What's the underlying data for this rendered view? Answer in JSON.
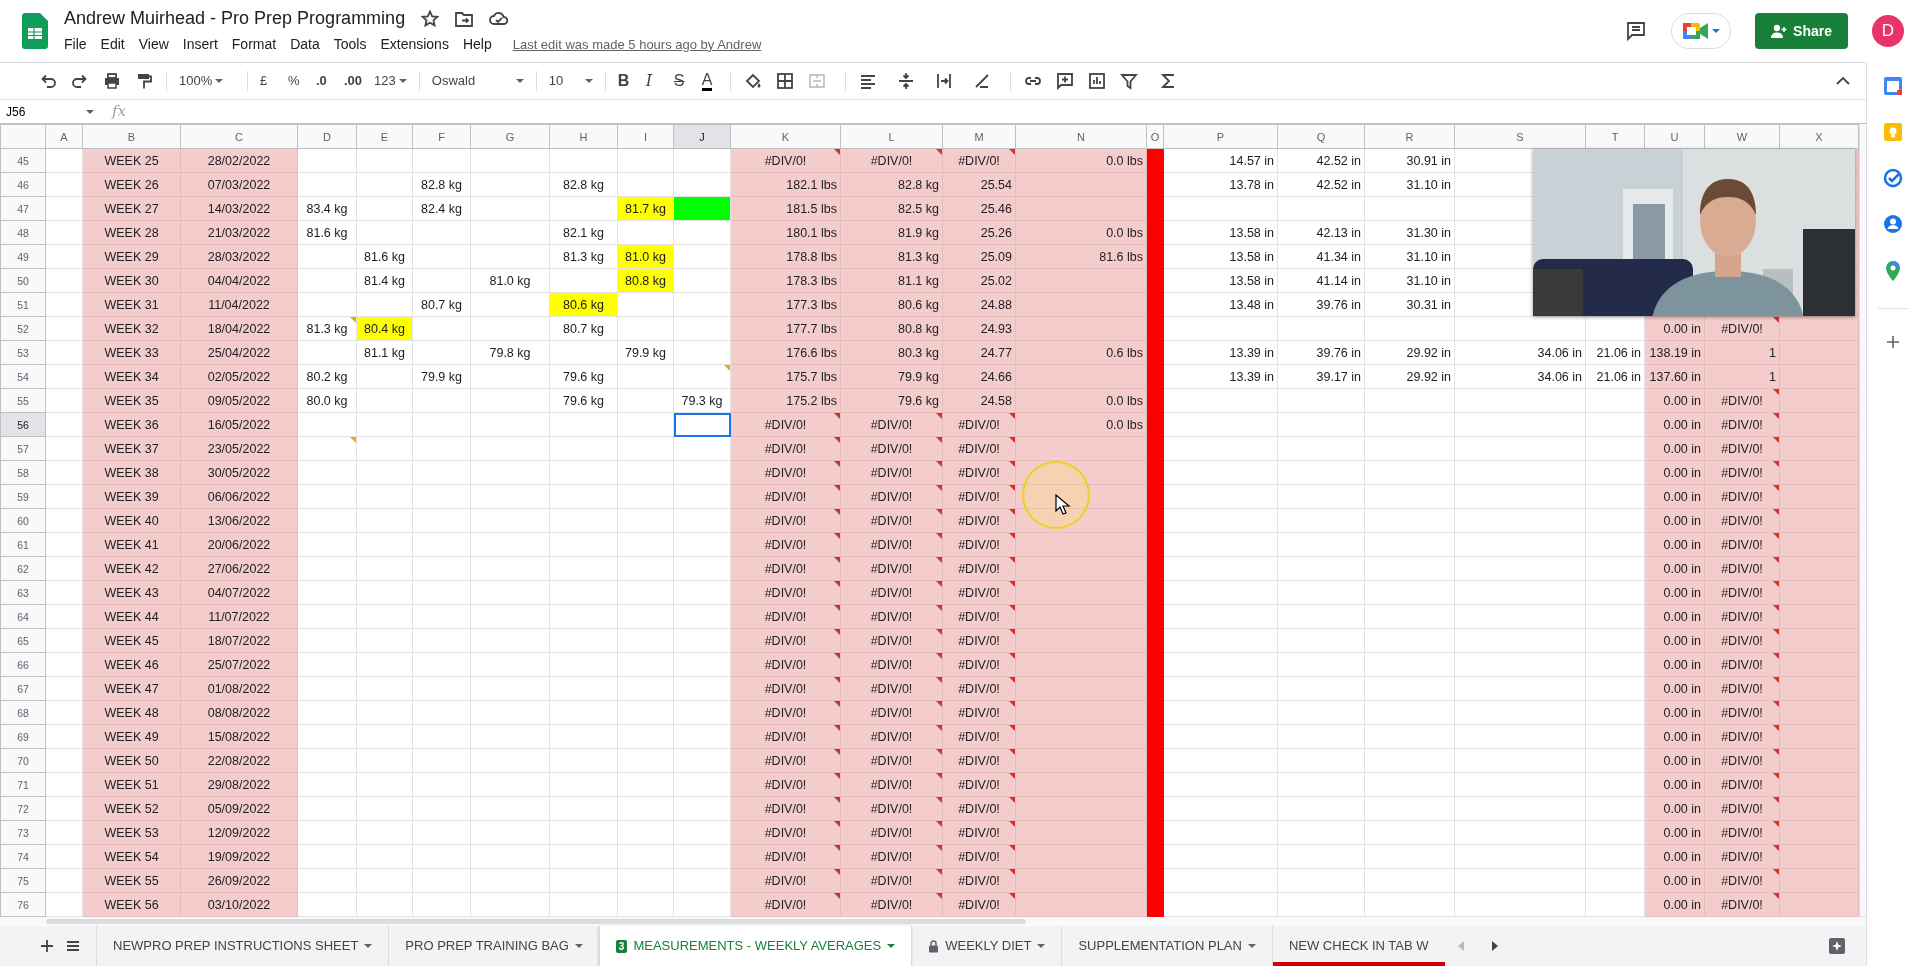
{
  "document": {
    "title": "Andrew Muirhead - Pro Prep Programming",
    "last_edit": "Last edit was made 5 hours ago by Andrew"
  },
  "menu": [
    "File",
    "Edit",
    "View",
    "Insert",
    "Format",
    "Data",
    "Tools",
    "Extensions",
    "Help"
  ],
  "share_button": "Share",
  "avatar": "D",
  "toolbar": {
    "zoom": "100%",
    "currency": "£",
    "percent": "%",
    "decrease_decimals": ".0",
    "increase_decimals": ".00",
    "number_format": "123",
    "font": "Oswald",
    "font_size": "10",
    "bold": "B",
    "italic": "I",
    "strikethrough": "S",
    "text_color": "A"
  },
  "name_box": "J56",
  "formula_label": "fx",
  "columns": [
    {
      "letter": "A",
      "selected": false
    },
    {
      "letter": "B",
      "selected": false,
      "color": "#f4cccc"
    },
    {
      "letter": "C",
      "selected": false,
      "color": "#f4cccc"
    },
    {
      "letter": "D",
      "selected": false
    },
    {
      "letter": "E",
      "selected": false
    },
    {
      "letter": "F",
      "selected": false
    },
    {
      "letter": "G",
      "selected": false
    },
    {
      "letter": "H",
      "selected": false
    },
    {
      "letter": "I",
      "selected": false
    },
    {
      "letter": "J",
      "selected": true
    },
    {
      "letter": "K",
      "selected": false,
      "color": "#f4cccc"
    },
    {
      "letter": "L",
      "selected": false,
      "color": "#f4cccc"
    },
    {
      "letter": "M",
      "selected": false,
      "color": "#f4cccc"
    },
    {
      "letter": "N",
      "selected": false,
      "color": "#f4cccc"
    },
    {
      "letter": "O",
      "selected": false,
      "color": "#ff0000"
    },
    {
      "letter": "P",
      "selected": false
    },
    {
      "letter": "Q",
      "selected": false
    },
    {
      "letter": "R",
      "selected": false
    },
    {
      "letter": "S",
      "selected": false
    },
    {
      "letter": "T",
      "selected": false
    },
    {
      "letter": "U",
      "selected": false,
      "color": "#f4cccc"
    },
    {
      "letter": "W",
      "selected": false,
      "color": "#f4cccc"
    },
    {
      "letter": "X",
      "selected": false,
      "color": "#f4cccc"
    }
  ],
  "rows": [
    {
      "number": "45",
      "selected": false,
      "cells": {
        "B": {
          "text": "WEEK 25",
          "kind": "value"
        },
        "C": {
          "text": "28/02/2022",
          "kind": "value"
        },
        "K": {
          "text": "#DIV/0!",
          "kind": "error"
        },
        "L": {
          "text": "#DIV/0!",
          "kind": "error"
        },
        "M": {
          "text": "#DIV/0!",
          "kind": "error"
        },
        "N": {
          "text": "0.0 lbs",
          "kind": "value"
        },
        "P": {
          "text": "14.57 in",
          "kind": "value"
        },
        "Q": {
          "text": "42.52 in",
          "kind": "value"
        },
        "R": {
          "text": "30.91 in",
          "kind": "value"
        }
      }
    },
    {
      "number": "46",
      "selected": false,
      "cells": {
        "B": {
          "text": "WEEK 26",
          "kind": "value"
        },
        "C": {
          "text": "07/03/2022",
          "kind": "value"
        },
        "F": {
          "text": "82.8 kg",
          "kind": "value"
        },
        "H": {
          "text": "82.8 kg",
          "kind": "value"
        },
        "K": {
          "text": "182.1 lbs",
          "kind": "value"
        },
        "L": {
          "text": "82.8 kg",
          "kind": "value"
        },
        "M": {
          "text": "25.54",
          "kind": "value"
        },
        "P": {
          "text": "13.78 in",
          "kind": "value"
        },
        "Q": {
          "text": "42.52 in",
          "kind": "value"
        },
        "R": {
          "text": "31.10 in",
          "kind": "value"
        }
      }
    },
    {
      "number": "47",
      "selected": false,
      "cells": {
        "B": {
          "text": "WEEK 27",
          "kind": "value"
        },
        "C": {
          "text": "14/03/2022",
          "kind": "value"
        },
        "D": {
          "text": "83.4 kg",
          "kind": "value"
        },
        "F": {
          "text": "82.4 kg",
          "kind": "value"
        },
        "I": {
          "text": "81.7 kg",
          "kind": "value",
          "color": "#ffff00"
        },
        "J": {
          "color": "#00ff00"
        },
        "K": {
          "text": "181.5 lbs",
          "kind": "value"
        },
        "L": {
          "text": "82.5 kg",
          "kind": "value"
        },
        "M": {
          "text": "25.46",
          "kind": "value"
        }
      }
    },
    {
      "number": "48",
      "selected": false,
      "cells": {
        "B": {
          "text": "WEEK 28",
          "kind": "value"
        },
        "C": {
          "text": "21/03/2022",
          "kind": "value"
        },
        "D": {
          "text": "81.6 kg",
          "kind": "value"
        },
        "H": {
          "text": "82.1 kg",
          "kind": "value"
        },
        "K": {
          "text": "180.1 lbs",
          "kind": "value"
        },
        "L": {
          "text": "81.9 kg",
          "kind": "value"
        },
        "M": {
          "text": "25.26",
          "kind": "value"
        },
        "N": {
          "text": "0.0 lbs",
          "kind": "value"
        },
        "P": {
          "text": "13.58 in",
          "kind": "value"
        },
        "Q": {
          "text": "42.13 in",
          "kind": "value"
        },
        "R": {
          "text": "31.30 in",
          "kind": "value"
        }
      }
    },
    {
      "number": "49",
      "selected": false,
      "cells": {
        "B": {
          "text": "WEEK 29",
          "kind": "value"
        },
        "C": {
          "text": "28/03/2022",
          "kind": "value"
        },
        "E": {
          "text": "81.6 kg",
          "kind": "value"
        },
        "H": {
          "text": "81.3 kg",
          "kind": "value"
        },
        "I": {
          "text": "81.0 kg",
          "kind": "value",
          "color": "#ffff00"
        },
        "K": {
          "text": "178.8 lbs",
          "kind": "value"
        },
        "L": {
          "text": "81.3 kg",
          "kind": "value"
        },
        "M": {
          "text": "25.09",
          "kind": "value"
        },
        "N": {
          "text": "81.6 lbs",
          "kind": "value"
        },
        "P": {
          "text": "13.58 in",
          "kind": "value"
        },
        "Q": {
          "text": "41.34 in",
          "kind": "value"
        },
        "R": {
          "text": "31.10 in",
          "kind": "value"
        }
      }
    },
    {
      "number": "50",
      "selected": false,
      "cells": {
        "B": {
          "text": "WEEK 30",
          "kind": "value"
        },
        "C": {
          "text": "04/04/2022",
          "kind": "value"
        },
        "E": {
          "text": "81.4 kg",
          "kind": "value"
        },
        "G": {
          "text": "81.0 kg",
          "kind": "value"
        },
        "I": {
          "text": "80.8 kg",
          "kind": "value",
          "color": "#ffff00"
        },
        "K": {
          "text": "178.3 lbs",
          "kind": "value"
        },
        "L": {
          "text": "81.1 kg",
          "kind": "value"
        },
        "M": {
          "text": "25.02",
          "kind": "value"
        },
        "P": {
          "text": "13.58 in",
          "kind": "value"
        },
        "Q": {
          "text": "41.14 in",
          "kind": "value"
        },
        "R": {
          "text": "31.10 in",
          "kind": "value"
        }
      }
    },
    {
      "number": "51",
      "selected": false,
      "cells": {
        "B": {
          "text": "WEEK 31",
          "kind": "value"
        },
        "C": {
          "text": "11/04/2022",
          "kind": "value"
        },
        "F": {
          "text": "80.7 kg",
          "kind": "value"
        },
        "H": {
          "text": "80.6 kg",
          "kind": "value",
          "color": "#ffff00"
        },
        "K": {
          "text": "177.3 lbs",
          "kind": "value"
        },
        "L": {
          "text": "80.6 kg",
          "kind": "value"
        },
        "M": {
          "text": "24.88",
          "kind": "value"
        },
        "P": {
          "text": "13.48 in",
          "kind": "value"
        },
        "Q": {
          "text": "39.76 in",
          "kind": "value"
        },
        "R": {
          "text": "30.31 in",
          "kind": "value"
        }
      }
    },
    {
      "number": "52",
      "selected": false,
      "cells": {
        "B": {
          "text": "WEEK 32",
          "kind": "value"
        },
        "C": {
          "text": "18/04/2022",
          "kind": "value"
        },
        "D": {
          "text": "81.3 kg",
          "kind": "value",
          "note": true
        },
        "E": {
          "text": "80.4 kg",
          "kind": "value",
          "color": "#ffff00"
        },
        "H": {
          "text": "80.7 kg",
          "kind": "value"
        },
        "K": {
          "text": "177.7 lbs",
          "kind": "value"
        },
        "L": {
          "text": "80.8 kg",
          "kind": "value"
        },
        "M": {
          "text": "24.93",
          "kind": "value"
        },
        "U": {
          "text": "0.00 in",
          "kind": "value"
        },
        "W": {
          "text": "#DIV/0!",
          "kind": "error"
        }
      }
    },
    {
      "number": "53",
      "selected": false,
      "cells": {
        "B": {
          "text": "WEEK 33",
          "kind": "value"
        },
        "C": {
          "text": "25/04/2022",
          "kind": "value"
        },
        "E": {
          "text": "81.1 kg",
          "kind": "value"
        },
        "G": {
          "text": "79.8 kg",
          "kind": "value"
        },
        "I": {
          "text": "79.9 kg",
          "kind": "value"
        },
        "K": {
          "text": "176.6 lbs",
          "kind": "value"
        },
        "L": {
          "text": "80.3 kg",
          "kind": "value"
        },
        "M": {
          "text": "24.77",
          "kind": "value"
        },
        "N": {
          "text": "0.6 lbs",
          "kind": "value"
        },
        "P": {
          "text": "13.39 in",
          "kind": "value"
        },
        "Q": {
          "text": "39.76 in",
          "kind": "value"
        },
        "R": {
          "text": "29.92 in",
          "kind": "value"
        },
        "S": {
          "text": "34.06 in",
          "kind": "value"
        },
        "T": {
          "text": "21.06 in",
          "kind": "value"
        },
        "U": {
          "text": "138.19 in",
          "kind": "value"
        },
        "W": {
          "text": "1",
          "kind": "value"
        }
      }
    },
    {
      "number": "54",
      "selected": false,
      "cells": {
        "B": {
          "text": "WEEK 34",
          "kind": "value"
        },
        "C": {
          "text": "02/05/2022",
          "kind": "value"
        },
        "D": {
          "text": "80.2 kg",
          "kind": "value"
        },
        "F": {
          "text": "79.9 kg",
          "kind": "value"
        },
        "H": {
          "text": "79.6 kg",
          "kind": "value"
        },
        "J": {
          "note": true
        },
        "K": {
          "text": "175.7 lbs",
          "kind": "value"
        },
        "L": {
          "text": "79.9 kg",
          "kind": "value"
        },
        "M": {
          "text": "24.66",
          "kind": "value"
        },
        "P": {
          "text": "13.39 in",
          "kind": "value"
        },
        "Q": {
          "text": "39.17 in",
          "kind": "value"
        },
        "R": {
          "text": "29.92 in",
          "kind": "value"
        },
        "S": {
          "text": "34.06 in",
          "kind": "value"
        },
        "T": {
          "text": "21.06 in",
          "kind": "value"
        },
        "U": {
          "text": "137.60 in",
          "kind": "value"
        },
        "W": {
          "text": "1",
          "kind": "value"
        }
      }
    },
    {
      "number": "55",
      "selected": false,
      "cells": {
        "B": {
          "text": "WEEK 35",
          "kind": "value"
        },
        "C": {
          "text": "09/05/2022",
          "kind": "value"
        },
        "D": {
          "text": "80.0 kg",
          "kind": "value"
        },
        "H": {
          "text": "79.6 kg",
          "kind": "value"
        },
        "J": {
          "text": "79.3 kg",
          "kind": "value"
        },
        "K": {
          "text": "175.2 lbs",
          "kind": "value"
        },
        "L": {
          "text": "79.6 kg",
          "kind": "value"
        },
        "M": {
          "text": "24.58",
          "kind": "value"
        },
        "N": {
          "text": "0.0 lbs",
          "kind": "value"
        },
        "U": {
          "text": "0.00 in",
          "kind": "value"
        },
        "W": {
          "text": "#DIV/0!",
          "kind": "error"
        }
      }
    },
    {
      "number": "56",
      "selected": true,
      "cells": {
        "B": {
          "text": "WEEK 36",
          "kind": "value"
        },
        "C": {
          "text": "16/05/2022",
          "kind": "value"
        },
        "J": {
          "selected": true
        },
        "K": {
          "text": "#DIV/0!",
          "kind": "error"
        },
        "L": {
          "text": "#DIV/0!",
          "kind": "error"
        },
        "M": {
          "text": "#DIV/0!",
          "kind": "error"
        },
        "N": {
          "text": "0.0 lbs",
          "kind": "value"
        },
        "U": {
          "text": "0.00 in",
          "kind": "value"
        },
        "W": {
          "text": "#DIV/0!",
          "kind": "error"
        }
      }
    },
    {
      "number": "57",
      "selected": false,
      "cells": {
        "B": {
          "text": "WEEK 37",
          "kind": "value"
        },
        "C": {
          "text": "23/05/2022",
          "kind": "value"
        },
        "D": {
          "note": true
        },
        "K": {
          "text": "#DIV/0!",
          "kind": "error"
        },
        "L": {
          "text": "#DIV/0!",
          "kind": "error"
        },
        "M": {
          "text": "#DIV/0!",
          "kind": "error"
        },
        "U": {
          "text": "0.00 in",
          "kind": "value"
        },
        "W": {
          "text": "#DIV/0!",
          "kind": "error"
        }
      }
    },
    {
      "number": "58",
      "selected": false,
      "cells": {
        "B": {
          "text": "WEEK 38",
          "kind": "value"
        },
        "C": {
          "text": "30/05/2022",
          "kind": "value"
        },
        "K": {
          "text": "#DIV/0!",
          "kind": "error"
        },
        "L": {
          "text": "#DIV/0!",
          "kind": "error"
        },
        "M": {
          "text": "#DIV/0!",
          "kind": "error"
        },
        "U": {
          "text": "0.00 in",
          "kind": "value"
        },
        "W": {
          "text": "#DIV/0!",
          "kind": "error"
        }
      }
    },
    {
      "number": "59",
      "selected": false,
      "cells": {
        "B": {
          "text": "WEEK 39",
          "kind": "value"
        },
        "C": {
          "text": "06/06/2022",
          "kind": "value"
        },
        "K": {
          "text": "#DIV/0!",
          "kind": "error"
        },
        "L": {
          "text": "#DIV/0!",
          "kind": "error"
        },
        "M": {
          "text": "#DIV/0!",
          "kind": "error"
        },
        "U": {
          "text": "0.00 in",
          "kind": "value"
        },
        "W": {
          "text": "#DIV/0!",
          "kind": "error"
        }
      }
    },
    {
      "number": "60",
      "selected": false,
      "cells": {
        "B": {
          "text": "WEEK 40",
          "kind": "value"
        },
        "C": {
          "text": "13/06/2022",
          "kind": "value"
        },
        "K": {
          "text": "#DIV/0!",
          "kind": "error"
        },
        "L": {
          "text": "#DIV/0!",
          "kind": "error"
        },
        "M": {
          "text": "#DIV/0!",
          "kind": "error"
        },
        "U": {
          "text": "0.00 in",
          "kind": "value"
        },
        "W": {
          "text": "#DIV/0!",
          "kind": "error"
        }
      }
    },
    {
      "number": "61",
      "selected": false,
      "cells": {
        "B": {
          "text": "WEEK 41",
          "kind": "value"
        },
        "C": {
          "text": "20/06/2022",
          "kind": "value"
        },
        "K": {
          "text": "#DIV/0!",
          "kind": "error"
        },
        "L": {
          "text": "#DIV/0!",
          "kind": "error"
        },
        "M": {
          "text": "#DIV/0!",
          "kind": "error"
        },
        "U": {
          "text": "0.00 in",
          "kind": "value"
        },
        "W": {
          "text": "#DIV/0!",
          "kind": "error"
        }
      }
    },
    {
      "number": "62",
      "selected": false,
      "cells": {
        "B": {
          "text": "WEEK 42",
          "kind": "value"
        },
        "C": {
          "text": "27/06/2022",
          "kind": "value"
        },
        "K": {
          "text": "#DIV/0!",
          "kind": "error"
        },
        "L": {
          "text": "#DIV/0!",
          "kind": "error"
        },
        "M": {
          "text": "#DIV/0!",
          "kind": "error"
        },
        "U": {
          "text": "0.00 in",
          "kind": "value"
        },
        "W": {
          "text": "#DIV/0!",
          "kind": "error"
        }
      }
    },
    {
      "number": "63",
      "selected": false,
      "cells": {
        "B": {
          "text": "WEEK 43",
          "kind": "value"
        },
        "C": {
          "text": "04/07/2022",
          "kind": "value"
        },
        "K": {
          "text": "#DIV/0!",
          "kind": "error"
        },
        "L": {
          "text": "#DIV/0!",
          "kind": "error"
        },
        "M": {
          "text": "#DIV/0!",
          "kind": "error"
        },
        "U": {
          "text": "0.00 in",
          "kind": "value"
        },
        "W": {
          "text": "#DIV/0!",
          "kind": "error"
        }
      }
    },
    {
      "number": "64",
      "selected": false,
      "cells": {
        "B": {
          "text": "WEEK 44",
          "kind": "value"
        },
        "C": {
          "text": "11/07/2022",
          "kind": "value"
        },
        "K": {
          "text": "#DIV/0!",
          "kind": "error"
        },
        "L": {
          "text": "#DIV/0!",
          "kind": "error"
        },
        "M": {
          "text": "#DIV/0!",
          "kind": "error"
        },
        "U": {
          "text": "0.00 in",
          "kind": "value"
        },
        "W": {
          "text": "#DIV/0!",
          "kind": "error"
        }
      }
    },
    {
      "number": "65",
      "selected": false,
      "cells": {
        "B": {
          "text": "WEEK 45",
          "kind": "value"
        },
        "C": {
          "text": "18/07/2022",
          "kind": "value"
        },
        "K": {
          "text": "#DIV/0!",
          "kind": "error"
        },
        "L": {
          "text": "#DIV/0!",
          "kind": "error"
        },
        "M": {
          "text": "#DIV/0!",
          "kind": "error"
        },
        "U": {
          "text": "0.00 in",
          "kind": "value"
        },
        "W": {
          "text": "#DIV/0!",
          "kind": "error"
        }
      }
    },
    {
      "number": "66",
      "selected": false,
      "cells": {
        "B": {
          "text": "WEEK 46",
          "kind": "value"
        },
        "C": {
          "text": "25/07/2022",
          "kind": "value"
        },
        "K": {
          "text": "#DIV/0!",
          "kind": "error"
        },
        "L": {
          "text": "#DIV/0!",
          "kind": "error"
        },
        "M": {
          "text": "#DIV/0!",
          "kind": "error"
        },
        "U": {
          "text": "0.00 in",
          "kind": "value"
        },
        "W": {
          "text": "#DIV/0!",
          "kind": "error"
        }
      }
    },
    {
      "number": "67",
      "selected": false,
      "cells": {
        "B": {
          "text": "WEEK 47",
          "kind": "value"
        },
        "C": {
          "text": "01/08/2022",
          "kind": "value"
        },
        "K": {
          "text": "#DIV/0!",
          "kind": "error"
        },
        "L": {
          "text": "#DIV/0!",
          "kind": "error"
        },
        "M": {
          "text": "#DIV/0!",
          "kind": "error"
        },
        "U": {
          "text": "0.00 in",
          "kind": "value"
        },
        "W": {
          "text": "#DIV/0!",
          "kind": "error"
        }
      }
    },
    {
      "number": "68",
      "selected": false,
      "cells": {
        "B": {
          "text": "WEEK 48",
          "kind": "value"
        },
        "C": {
          "text": "08/08/2022",
          "kind": "value"
        },
        "K": {
          "text": "#DIV/0!",
          "kind": "error"
        },
        "L": {
          "text": "#DIV/0!",
          "kind": "error"
        },
        "M": {
          "text": "#DIV/0!",
          "kind": "error"
        },
        "U": {
          "text": "0.00 in",
          "kind": "value"
        },
        "W": {
          "text": "#DIV/0!",
          "kind": "error"
        }
      }
    },
    {
      "number": "69",
      "selected": false,
      "cells": {
        "B": {
          "text": "WEEK 49",
          "kind": "value"
        },
        "C": {
          "text": "15/08/2022",
          "kind": "value"
        },
        "K": {
          "text": "#DIV/0!",
          "kind": "error"
        },
        "L": {
          "text": "#DIV/0!",
          "kind": "error"
        },
        "M": {
          "text": "#DIV/0!",
          "kind": "error"
        },
        "U": {
          "text": "0.00 in",
          "kind": "value"
        },
        "W": {
          "text": "#DIV/0!",
          "kind": "error"
        }
      }
    },
    {
      "number": "70",
      "selected": false,
      "cells": {
        "B": {
          "text": "WEEK 50",
          "kind": "value"
        },
        "C": {
          "text": "22/08/2022",
          "kind": "value"
        },
        "K": {
          "text": "#DIV/0!",
          "kind": "error"
        },
        "L": {
          "text": "#DIV/0!",
          "kind": "error"
        },
        "M": {
          "text": "#DIV/0!",
          "kind": "error"
        },
        "U": {
          "text": "0.00 in",
          "kind": "value"
        },
        "W": {
          "text": "#DIV/0!",
          "kind": "error"
        }
      }
    },
    {
      "number": "71",
      "selected": false,
      "cells": {
        "B": {
          "text": "WEEK 51",
          "kind": "value"
        },
        "C": {
          "text": "29/08/2022",
          "kind": "value"
        },
        "K": {
          "text": "#DIV/0!",
          "kind": "error"
        },
        "L": {
          "text": "#DIV/0!",
          "kind": "error"
        },
        "M": {
          "text": "#DIV/0!",
          "kind": "error"
        },
        "U": {
          "text": "0.00 in",
          "kind": "value"
        },
        "W": {
          "text": "#DIV/0!",
          "kind": "error"
        }
      }
    },
    {
      "number": "72",
      "selected": false,
      "cells": {
        "B": {
          "text": "WEEK 52",
          "kind": "value"
        },
        "C": {
          "text": "05/09/2022",
          "kind": "value"
        },
        "K": {
          "text": "#DIV/0!",
          "kind": "error"
        },
        "L": {
          "text": "#DIV/0!",
          "kind": "error"
        },
        "M": {
          "text": "#DIV/0!",
          "kind": "error"
        },
        "U": {
          "text": "0.00 in",
          "kind": "value"
        },
        "W": {
          "text": "#DIV/0!",
          "kind": "error"
        }
      }
    },
    {
      "number": "73",
      "selected": false,
      "cells": {
        "B": {
          "text": "WEEK 53",
          "kind": "value"
        },
        "C": {
          "text": "12/09/2022",
          "kind": "value"
        },
        "K": {
          "text": "#DIV/0!",
          "kind": "error"
        },
        "L": {
          "text": "#DIV/0!",
          "kind": "error"
        },
        "M": {
          "text": "#DIV/0!",
          "kind": "error"
        },
        "U": {
          "text": "0.00 in",
          "kind": "value"
        },
        "W": {
          "text": "#DIV/0!",
          "kind": "error"
        }
      }
    },
    {
      "number": "74",
      "selected": false,
      "cells": {
        "B": {
          "text": "WEEK 54",
          "kind": "value"
        },
        "C": {
          "text": "19/09/2022",
          "kind": "value"
        },
        "K": {
          "text": "#DIV/0!",
          "kind": "error"
        },
        "L": {
          "text": "#DIV/0!",
          "kind": "error"
        },
        "M": {
          "text": "#DIV/0!",
          "kind": "error"
        },
        "U": {
          "text": "0.00 in",
          "kind": "value"
        },
        "W": {
          "text": "#DIV/0!",
          "kind": "error"
        }
      }
    },
    {
      "number": "75",
      "selected": false,
      "cells": {
        "B": {
          "text": "WEEK 55",
          "kind": "value"
        },
        "C": {
          "text": "26/09/2022",
          "kind": "value"
        },
        "K": {
          "text": "#DIV/0!",
          "kind": "error"
        },
        "L": {
          "text": "#DIV/0!",
          "kind": "error"
        },
        "M": {
          "text": "#DIV/0!",
          "kind": "error"
        },
        "U": {
          "text": "0.00 in",
          "kind": "value"
        },
        "W": {
          "text": "#DIV/0!",
          "kind": "error"
        }
      }
    },
    {
      "number": "76",
      "selected": false,
      "cells": {
        "B": {
          "text": "WEEK 56",
          "kind": "value"
        },
        "C": {
          "text": "03/10/2022",
          "kind": "value"
        },
        "K": {
          "text": "#DIV/0!",
          "kind": "error"
        },
        "L": {
          "text": "#DIV/0!",
          "kind": "error"
        },
        "M": {
          "text": "#DIV/0!",
          "kind": "error"
        },
        "U": {
          "text": "0.00 in",
          "kind": "value"
        },
        "W": {
          "text": "#DIV/0!",
          "kind": "error"
        }
      }
    }
  ],
  "sheet_tabs": [
    {
      "label": "NEWPRO PREP INSTRUCTIONS SHEET",
      "selected": false,
      "locked": false
    },
    {
      "label": "PRO PREP TRAINING BAG",
      "selected": false,
      "locked": false
    },
    {
      "label": "MEASUREMENTS - WEEKLY AVERAGES",
      "selected": true,
      "locked": false,
      "badge": "3"
    },
    {
      "label": "WEEKLY DIET",
      "selected": false,
      "locked": true
    },
    {
      "label": "SUPPLEMENTATION PLAN",
      "selected": false,
      "locked": false
    },
    {
      "label": "NEW CHECK IN TAB W",
      "selected": false,
      "locked": false,
      "color": "#cc0000"
    }
  ]
}
